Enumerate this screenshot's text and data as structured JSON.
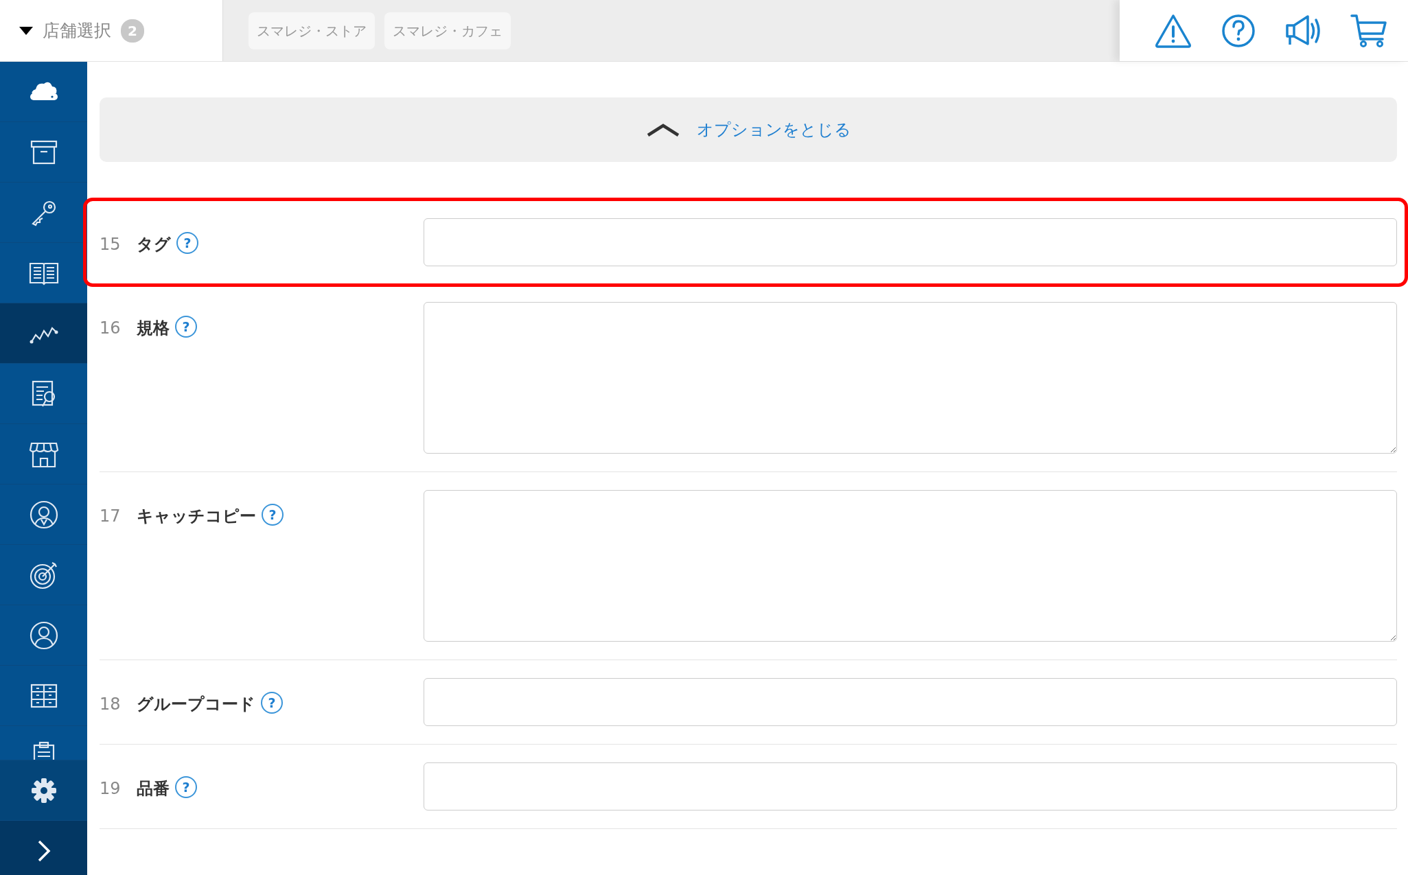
{
  "store_selector": {
    "label": "店舗選択",
    "count": "2",
    "expanded": true
  },
  "stores": [
    {
      "label": "スマレジ・ストア"
    },
    {
      "label": "スマレジ・カフェ"
    }
  ],
  "header_icons": [
    {
      "kind": "warning"
    },
    {
      "kind": "help"
    },
    {
      "kind": "announce"
    },
    {
      "kind": "cart"
    }
  ],
  "sidebar": {
    "items": [
      {
        "kind": "cloud",
        "selected": false
      },
      {
        "kind": "box",
        "selected": false
      },
      {
        "kind": "key",
        "selected": false
      },
      {
        "kind": "book",
        "selected": false
      },
      {
        "kind": "chart",
        "selected": true
      },
      {
        "kind": "report",
        "selected": false
      },
      {
        "kind": "store",
        "selected": false
      },
      {
        "kind": "badge",
        "selected": false
      },
      {
        "kind": "target",
        "selected": false
      },
      {
        "kind": "person",
        "selected": false
      },
      {
        "kind": "grid",
        "selected": false
      },
      {
        "kind": "clipboard",
        "selected": false
      }
    ],
    "footer": [
      {
        "kind": "settings"
      },
      {
        "kind": "expand"
      }
    ]
  },
  "options_toggle": {
    "label": "オプションをとじる",
    "expanded": true
  },
  "fields": [
    {
      "number": "15",
      "label": "タグ",
      "help": "?",
      "kind": "input",
      "highlighted": true
    },
    {
      "number": "16",
      "label": "規格",
      "help": "?",
      "kind": "textarea",
      "highlighted": false
    },
    {
      "number": "17",
      "label": "キャッチコピー",
      "help": "?",
      "kind": "textarea",
      "highlighted": false
    },
    {
      "number": "18",
      "label": "グループコード",
      "help": "?",
      "kind": "input",
      "highlighted": false
    },
    {
      "number": "19",
      "label": "品番",
      "help": "?",
      "kind": "input",
      "highlighted": false
    }
  ]
}
